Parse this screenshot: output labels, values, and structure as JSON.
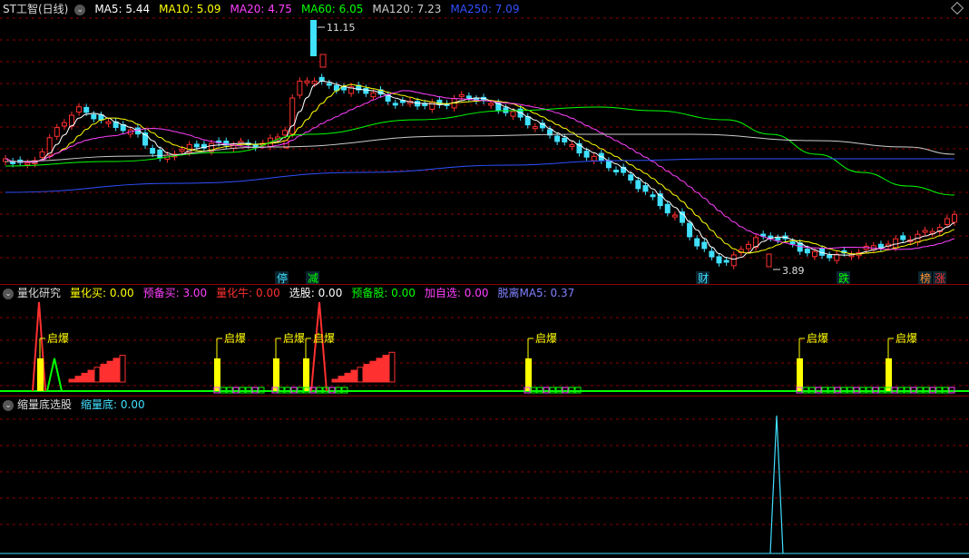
{
  "main_header": {
    "stock_name": "ST工智(日线)",
    "ma_items": [
      {
        "label": "MA5: 5.44",
        "color": "#ffffff"
      },
      {
        "label": "MA10: 5.09",
        "color": "#ffff00"
      },
      {
        "label": "MA20: 4.75",
        "color": "#ff40ff"
      },
      {
        "label": "MA60: 6.05",
        "color": "#00ff00"
      },
      {
        "label": "MA120: 7.23",
        "color": "#cccccc"
      },
      {
        "label": "MA250: 7.09",
        "color": "#3050ff"
      }
    ]
  },
  "quant_header": {
    "title": "量化研究",
    "items": [
      {
        "label": "量化买: 0.00",
        "color": "#ffff00"
      },
      {
        "label": "预备买: 3.00",
        "color": "#ff40ff"
      },
      {
        "label": "量化牛: 0.00",
        "color": "#ff3030"
      },
      {
        "label": "选股: 0.00",
        "color": "#ffffff"
      },
      {
        "label": "预备股: 0.00",
        "color": "#00ff00"
      },
      {
        "label": "加自选: 0.00",
        "color": "#ff40ff"
      },
      {
        "label": "脱离MA5: 0.37",
        "color": "#8080ff"
      }
    ]
  },
  "bottom_header": {
    "title": "缩量底选股",
    "items": [
      {
        "label": "缩量底: 0.00",
        "color": "#40e0ff"
      }
    ]
  },
  "colors": {
    "up": "#ff3030",
    "down": "#40e0ff",
    "grid": "#8b0000",
    "ma5": "#ffffff",
    "ma10": "#ffff00",
    "ma20": "#ff40ff",
    "ma60": "#00ff00",
    "ma120": "#cccccc",
    "ma250": "#3050ff"
  },
  "chart_data": [
    {
      "type": "candlestick",
      "title": "ST工智(日线)",
      "ylim": [
        3.5,
        11.5
      ],
      "high_label": "11.15",
      "low_label": "3.89",
      "ma_series": [
        {
          "name": "MA5",
          "color": "#ffffff"
        },
        {
          "name": "MA10",
          "color": "#ffff00"
        },
        {
          "name": "MA20",
          "color": "#ff40ff"
        },
        {
          "name": "MA60",
          "color": "#00ff00"
        },
        {
          "name": "MA120",
          "color": "#cccccc"
        },
        {
          "name": "MA250",
          "color": "#3050ff"
        }
      ],
      "event_markers": [
        {
          "label": "停",
          "color": "#40e0ff"
        },
        {
          "label": "减",
          "color": "#00ff00"
        },
        {
          "label": "财",
          "color": "#40e0ff"
        },
        {
          "label": "跌",
          "color": "#00ff00"
        },
        {
          "label": "榜",
          "color": "#ff9030"
        },
        {
          "label": "涨",
          "color": "#ff3030"
        }
      ]
    },
    {
      "type": "bar",
      "title": "量化研究",
      "signal_label": "启爆",
      "signal_count": 7
    },
    {
      "type": "line",
      "title": "缩量底选股",
      "series": [
        {
          "name": "缩量底",
          "color": "#40e0ff"
        }
      ]
    }
  ]
}
